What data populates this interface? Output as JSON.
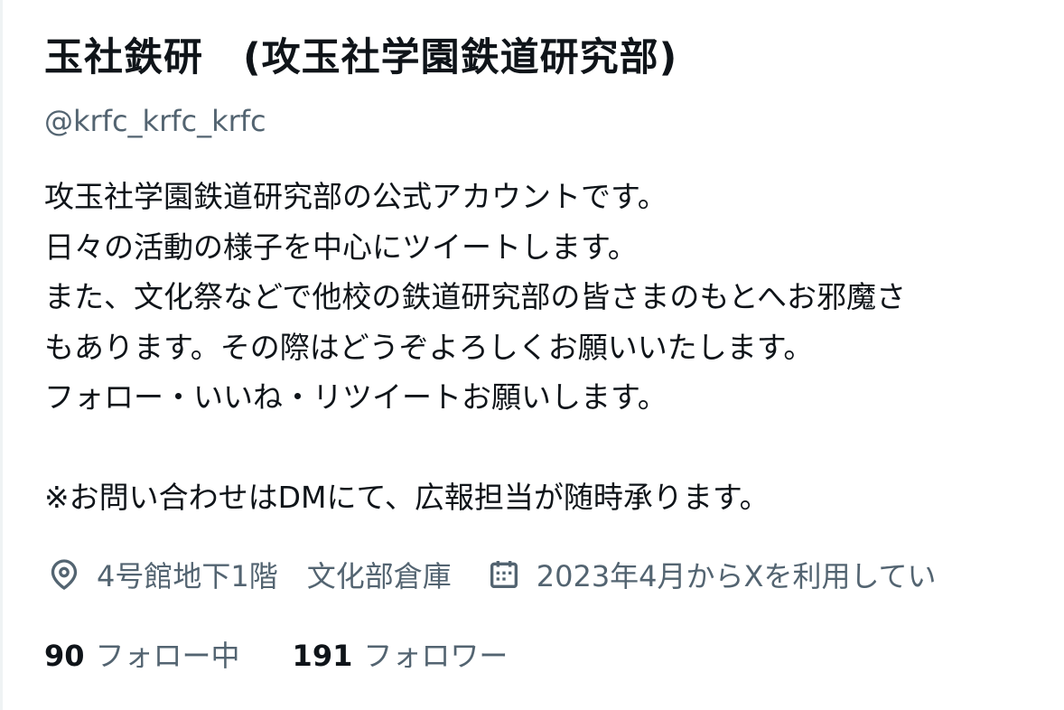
{
  "profile": {
    "display_name": "玉社鉄研　(攻玉社学園鉄道研究部)",
    "handle": "@krfc_krfc_krfc",
    "bio_lines": [
      "攻玉社学園鉄道研究部の公式アカウントです。",
      "日々の活動の様子を中心にツイートします。",
      "また、文化祭などで他校の鉄道研究部の皆さまのもとへお邪魔さ",
      "もあります。その際はどうぞよろしくお願いいたします。",
      "フォロー・いいね・リツイートお願いします。",
      "",
      "※お問い合わせはDMにて、広報担当が随時承ります。"
    ],
    "location_icon": "location-pin-icon",
    "location": "4号館地下1階　文化部倉庫",
    "joined_icon": "calendar-icon",
    "joined": "2023年4月からXを利用してい",
    "following_count": "90",
    "following_label": "フォロー中",
    "followers_count": "191",
    "followers_label": "フォロワー"
  },
  "colors": {
    "text_primary": "#0f1419",
    "text_secondary": "#536471",
    "border": "#eff3f4"
  }
}
